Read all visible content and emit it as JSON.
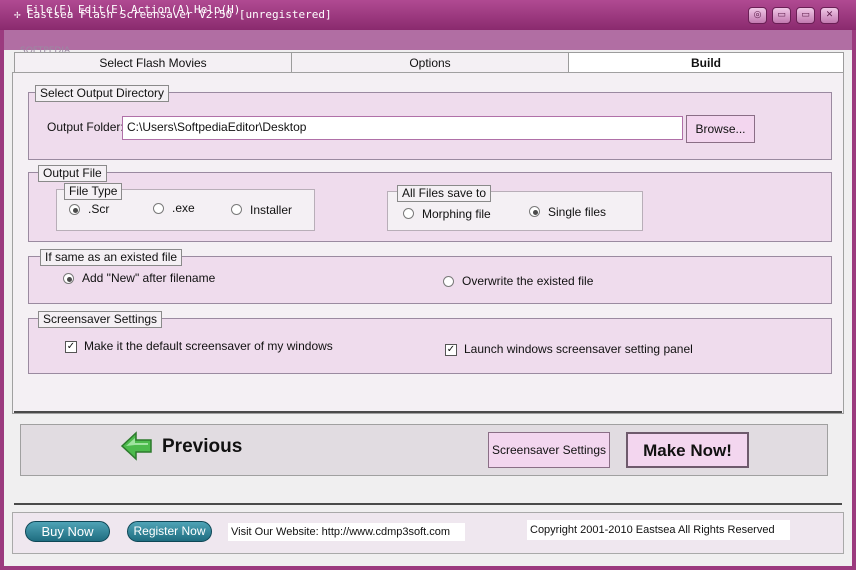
{
  "window": {
    "title": "Eastsea Flash Screensaver V2.50 [unregistered]",
    "controls": {
      "minimize": "◎",
      "restore": "▭",
      "maximize": "▭",
      "close": "✕"
    }
  },
  "watermark": "SOFTPEDIA",
  "menu": [
    {
      "label": "File(F)"
    },
    {
      "label": "Edit(E)"
    },
    {
      "label": "Action(A)"
    },
    {
      "label": "Help(H)"
    }
  ],
  "tabs": [
    {
      "label": "Select Flash Movies"
    },
    {
      "label": "Options"
    },
    {
      "label": "Build"
    }
  ],
  "output_dir": {
    "title": "Select Output Directory",
    "folder_label": "Output Folder:",
    "folder_value": "C:\\Users\\SoftpediaEditor\\Desktop",
    "browse_label": "Browse..."
  },
  "output_file": {
    "title": "Output File",
    "file_type": {
      "title": "File Type",
      "options": [
        ".Scr",
        ".exe",
        "Installer"
      ],
      "selected": ".Scr"
    },
    "save_to": {
      "title": "All Files save to",
      "options": [
        "Morphing file",
        "Single files"
      ],
      "selected": "Single files"
    }
  },
  "existing_file": {
    "title": "If same as an existed file",
    "options": [
      "Add \"New\" after filename",
      "Overwrite the existed file"
    ],
    "selected": "Add \"New\" after filename"
  },
  "screensaver_settings": {
    "title": "Screensaver Settings",
    "default_label": "Make it the default screensaver of my windows",
    "default_checked": true,
    "launch_label": "Launch windows screensaver setting panel",
    "launch_checked": true
  },
  "actions": {
    "previous_label": "Previous",
    "settings_label": "Screensaver Settings",
    "make_label": "Make Now!"
  },
  "footer": {
    "buy_label": "Buy Now",
    "register_label": "Register Now",
    "website_text": "Visit Our Website: http://www.cdmp3soft.com",
    "copyright_text": "Copyright 2001-2010 Eastsea All Rights Reserved"
  },
  "colors": {
    "titlebar": "#9b3a7e",
    "group_background": "#efdced",
    "button_background": "#f3d6ef",
    "pill_button": "#2a7d90",
    "arrow_green": "#3aa63a"
  }
}
